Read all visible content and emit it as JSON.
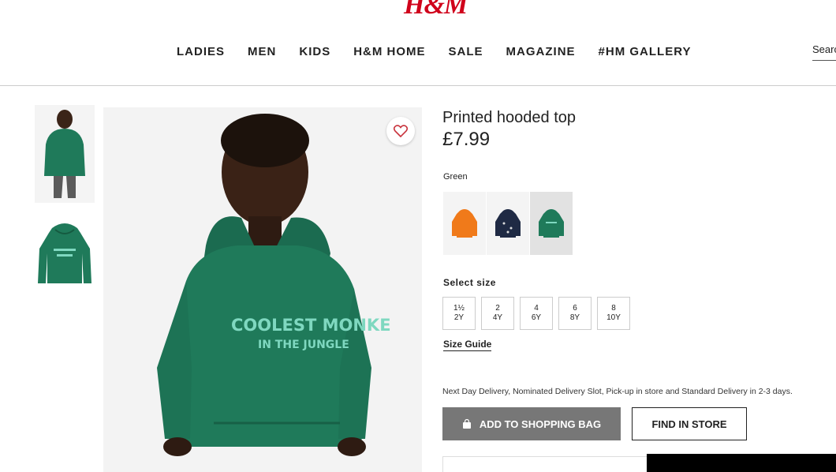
{
  "brand": {
    "logo": "H&M"
  },
  "nav": [
    "LADIES",
    "MEN",
    "KIDS",
    "H&M HOME",
    "SALE",
    "MAGAZINE",
    "#HM GALLERY"
  ],
  "search": {
    "label": "Search"
  },
  "product": {
    "title": "Printed hooded top",
    "price": "£7.99",
    "print_line1": "COOLEST MONKE",
    "print_line2": "IN THE JUNGLE",
    "color_label": "Green",
    "swatch_colors": [
      "#f07a1a",
      "#1f2a44",
      "#1f7a5a"
    ],
    "selected_swatch": 2,
    "size_label": "Select size",
    "sizes": [
      {
        "top": "1½",
        "bottom": "2Y"
      },
      {
        "top": "2",
        "bottom": "4Y"
      },
      {
        "top": "4",
        "bottom": "6Y"
      },
      {
        "top": "6",
        "bottom": "8Y"
      },
      {
        "top": "8",
        "bottom": "10Y"
      }
    ],
    "size_guide": "Size Guide",
    "delivery": "Next Day Delivery, Nominated Delivery Slot, Pick-up in store and Standard Delivery in 2-3 days.",
    "add_to_bag": "ADD TO SHOPPING BAG",
    "find_in_store": "FIND IN STORE"
  },
  "colors": {
    "brand_red": "#d0021b",
    "hoodie_green": "#1f7a5a",
    "print_mint": "#7fd8c0"
  }
}
